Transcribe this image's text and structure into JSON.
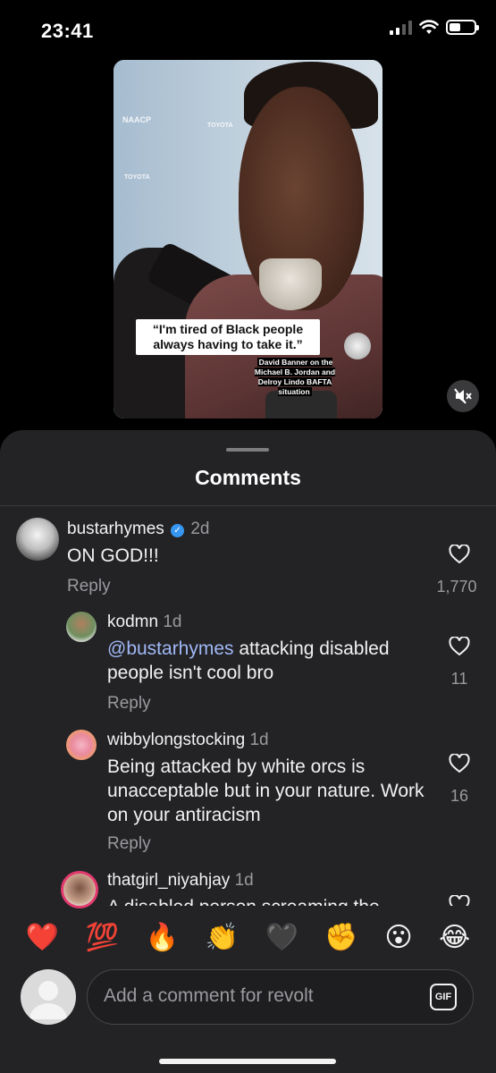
{
  "status_bar": {
    "time": "23:41"
  },
  "video": {
    "quote": "“I'm tired of Black people always having to take it.”",
    "caption": "David Banner on the Michael B. Jordan and Delroy Lindo BAFTA situation",
    "logo_1": "NAACP",
    "logo_2": "TOYOTA"
  },
  "comments_sheet": {
    "title": "Comments",
    "reply_label": "Reply",
    "comments": [
      {
        "user": "bustarhymes",
        "verified": true,
        "time": "2d",
        "text": "ON GOD!!!",
        "likes": "1,770"
      },
      {
        "user": "kodmn",
        "time": "1d",
        "mention": "@bustarhymes",
        "text": " attacking disabled people isn't cool bro",
        "likes": "11"
      },
      {
        "user": "wibbylongstocking",
        "time": "1d",
        "text": "Being attacked by white orcs is unacceptable but in your nature. Work on your antiracism",
        "likes": "16"
      },
      {
        "user": "thatgirl_niyahjay",
        "time": "1d",
        "text": "A disabled person screaming the"
      }
    ]
  },
  "emoji_bar": [
    "❤️",
    "💯",
    "🔥",
    "👏",
    "🖤",
    "✊",
    "😮",
    "😂"
  ],
  "compose": {
    "placeholder": "Add a comment for revolt",
    "gif_label": "GIF"
  },
  "colors": {
    "sheet_bg": "#232326",
    "mention": "#a0b8f5",
    "verified": "#3797f0"
  }
}
